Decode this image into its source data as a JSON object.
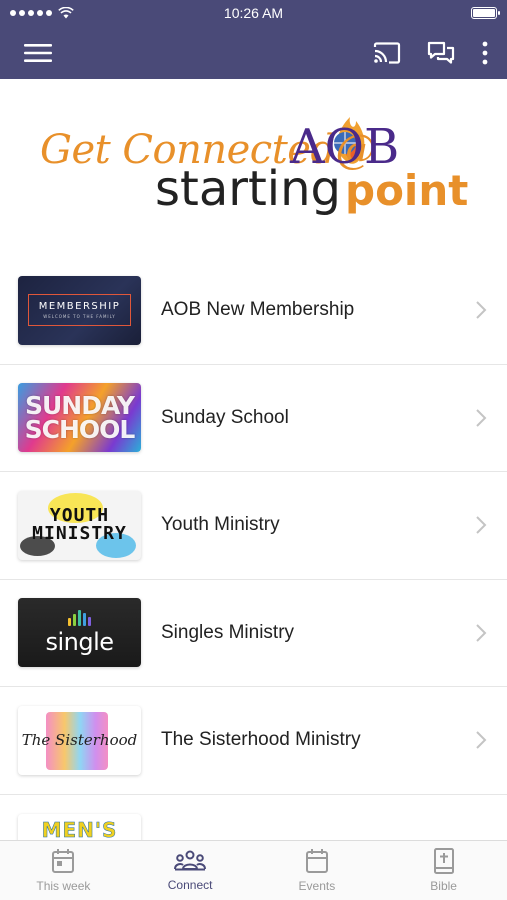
{
  "status_bar": {
    "time": "10:26 AM"
  },
  "toolbar": {
    "menu_icon": "hamburger-menu-icon",
    "cast_icon": "cast-icon",
    "chat_icon": "chat-bubbles-icon",
    "more_icon": "more-vertical-icon"
  },
  "banner": {
    "line1": "Get Connected@",
    "brand": "AOB",
    "line2_a": "starting",
    "line2_b": "point"
  },
  "list": {
    "items": [
      {
        "label": "AOB New Membership",
        "thumb_text": "MEMBERSHIP",
        "thumb_sub": "WELCOME TO THE FAMILY"
      },
      {
        "label": "Sunday School",
        "thumb_line1": "SUNDAY",
        "thumb_line2": "SCHOOL"
      },
      {
        "label": "Youth Ministry",
        "thumb_line1": "YOUTH",
        "thumb_line2": "MINISTRY"
      },
      {
        "label": "Singles Ministry",
        "thumb_text": "single"
      },
      {
        "label": "The Sisterhood Ministry",
        "thumb_text": "The Sisterhood"
      },
      {
        "label": "",
        "thumb_text": "MEN'S"
      }
    ]
  },
  "tabbar": {
    "tabs": [
      {
        "label": "This week",
        "icon": "calendar-today-icon",
        "active": false
      },
      {
        "label": "Connect",
        "icon": "people-group-icon",
        "active": true
      },
      {
        "label": "Events",
        "icon": "calendar-icon",
        "active": false
      },
      {
        "label": "Bible",
        "icon": "bible-icon",
        "active": false
      }
    ]
  },
  "colors": {
    "header_bg": "#4a4a78",
    "banner_orange": "#e8902a",
    "banner_purple": "#4a2a8a",
    "tab_active": "#4a4a78",
    "tab_inactive": "#9a9a9a"
  }
}
